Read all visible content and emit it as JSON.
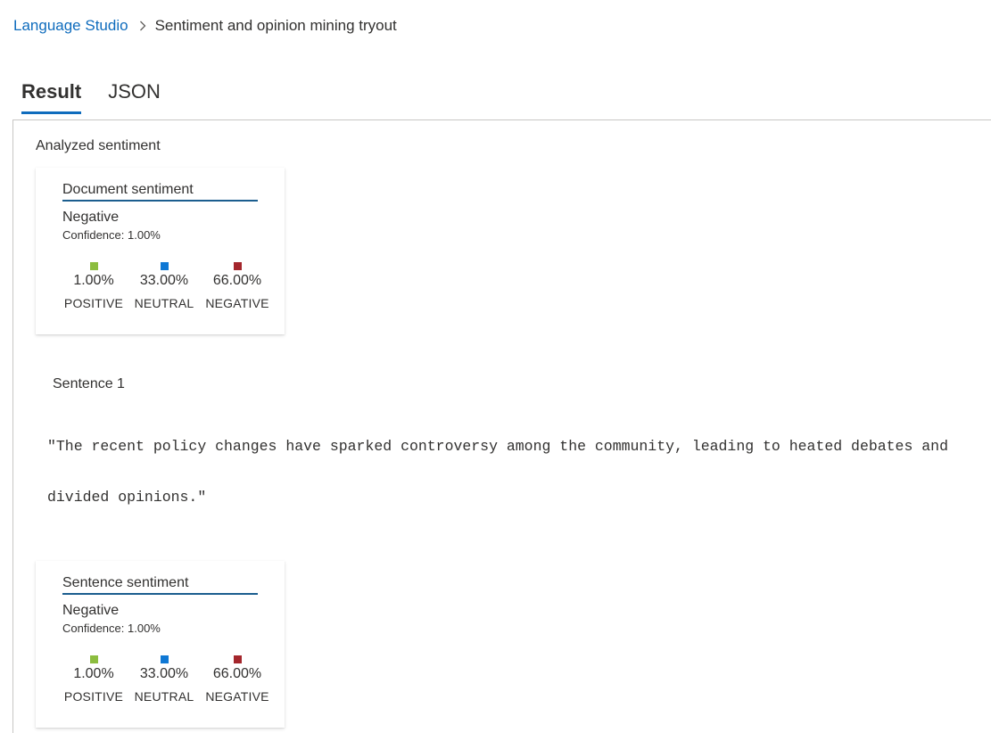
{
  "breadcrumb": {
    "root": "Language Studio",
    "current": "Sentiment and opinion mining tryout",
    "separator_icon": "chevron-right-icon"
  },
  "tabs": [
    {
      "label": "Result",
      "active": true
    },
    {
      "label": "JSON",
      "active": false
    }
  ],
  "section_title": "Analyzed sentiment",
  "colors": {
    "positive": "#8cbd3f",
    "neutral": "#0f78d4",
    "negative": "#a4262c",
    "accent": "#0f6cbd"
  },
  "document_card": {
    "title": "Document sentiment",
    "label": "Negative",
    "confidence": "Confidence: 1.00%",
    "metrics": [
      {
        "value": "1.00%",
        "name": "POSITIVE"
      },
      {
        "value": "33.00%",
        "name": "NEUTRAL"
      },
      {
        "value": "66.00%",
        "name": "NEGATIVE"
      }
    ]
  },
  "sentence": {
    "heading": "Sentence 1",
    "text": "\"The recent policy changes have sparked controversy among the community, leading to heated debates and divided opinions.\""
  },
  "sentence_card": {
    "title": "Sentence sentiment",
    "label": "Negative",
    "confidence": "Confidence: 1.00%",
    "metrics": [
      {
        "value": "1.00%",
        "name": "POSITIVE"
      },
      {
        "value": "33.00%",
        "name": "NEUTRAL"
      },
      {
        "value": "66.00%",
        "name": "NEGATIVE"
      }
    ]
  }
}
